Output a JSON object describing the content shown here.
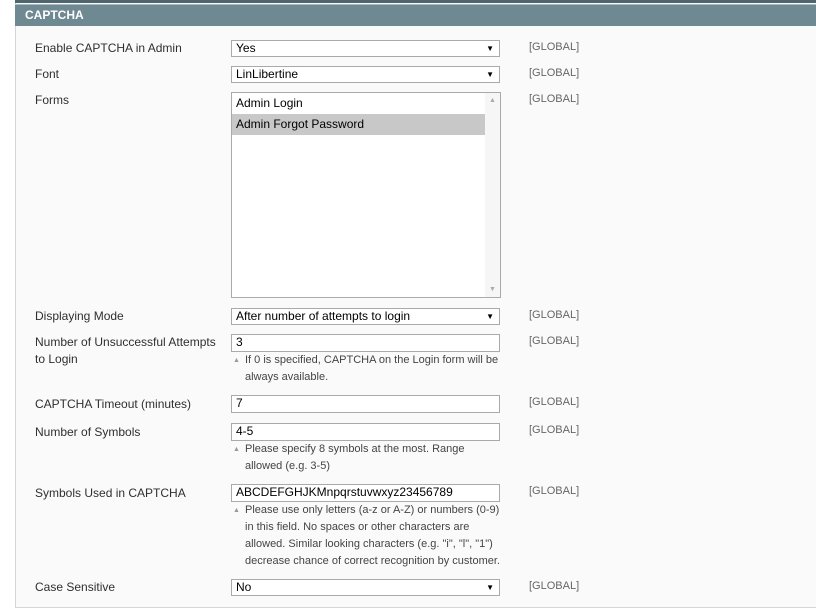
{
  "section": {
    "title": "CAPTCHA"
  },
  "scope": "[GLOBAL]",
  "fields": {
    "enable": {
      "label": "Enable CAPTCHA in Admin",
      "value": "Yes"
    },
    "font": {
      "label": "Font",
      "value": "LinLibertine"
    },
    "forms": {
      "label": "Forms",
      "options": [
        {
          "label": "Admin Login",
          "selected": false
        },
        {
          "label": "Admin Forgot Password",
          "selected": true
        }
      ]
    },
    "mode": {
      "label": "Displaying Mode",
      "value": "After number of attempts to login"
    },
    "attempts": {
      "label": "Number of Unsuccessful Attempts to Login",
      "value": "3",
      "note": "If 0 is specified, CAPTCHA on the Login form will be always available."
    },
    "timeout": {
      "label": "CAPTCHA Timeout (minutes)",
      "value": "7"
    },
    "symbols": {
      "label": "Number of Symbols",
      "value": "4-5",
      "note": "Please specify 8 symbols at the most. Range allowed (e.g. 3-5)"
    },
    "used": {
      "label": "Symbols Used in CAPTCHA",
      "value": "ABCDEFGHJKMnpqrstuvwxyz23456789",
      "note": "Please use only letters (a-z or A-Z) or numbers (0-9) in this field. No spaces or other characters are allowed. Similar looking characters (e.g. \"i\", \"l\", \"1\") decrease chance of correct recognition by customer."
    },
    "case": {
      "label": "Case Sensitive",
      "value": "No"
    }
  }
}
